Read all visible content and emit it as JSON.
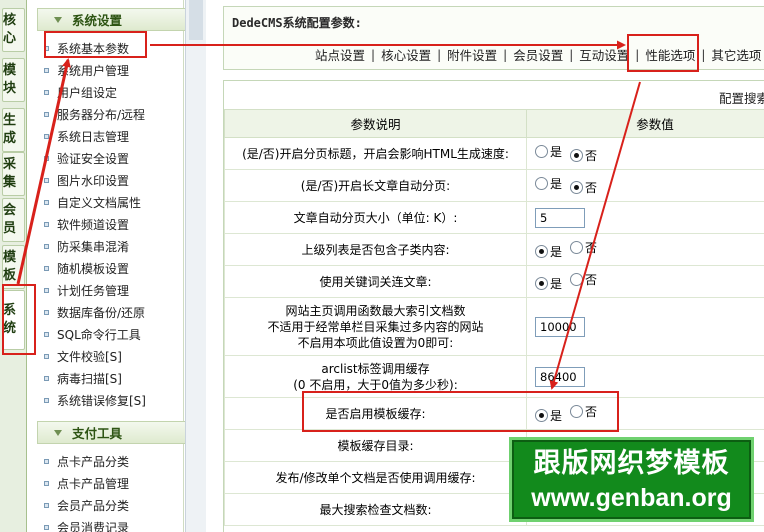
{
  "vertical_tabs": [
    "核心",
    "模块",
    "生成",
    "采集",
    "会员",
    "模板",
    "系统"
  ],
  "menu": {
    "sections": [
      {
        "title": "系统设置",
        "items": [
          "系统基本参数",
          "系统用户管理",
          "用户组设定",
          "服务器分布/远程",
          "系统日志管理",
          "验证安全设置",
          "图片水印设置",
          "自定义文档属性",
          "软件频道设置",
          "防采集串混淆",
          "随机模板设置",
          "计划任务管理",
          "数据库备份/还原",
          "SQL命令行工具",
          "文件校验[S]",
          "病毒扫描[S]",
          "系统错误修复[S]"
        ]
      },
      {
        "title": "支付工具",
        "items": [
          "点卡产品分类",
          "点卡产品管理",
          "会员产品分类",
          "会员消费记录"
        ]
      }
    ]
  },
  "main": {
    "title": "DedeCMS系统配置参数:",
    "tabs": [
      "站点设置",
      "核心设置",
      "附件设置",
      "会员设置",
      "互动设置",
      "性能选项",
      "其它选项"
    ],
    "config_search": "配置搜索",
    "table": {
      "headers": [
        "参数说明",
        "参数值"
      ],
      "rows": [
        {
          "desc": "(是/否)开启分页标题，开启会影响HTML生成速度:",
          "type": "radio",
          "selected": "否"
        },
        {
          "desc": "(是/否)开启长文章自动分页:",
          "type": "radio",
          "selected": "否"
        },
        {
          "desc": "文章自动分页大小（单位: K）:",
          "type": "text",
          "value": "5"
        },
        {
          "desc": "上级列表是否包含子类内容:",
          "type": "radio",
          "selected": "是"
        },
        {
          "desc": "使用关键词关连文章:",
          "type": "radio",
          "selected": "是"
        },
        {
          "desc": "网站主页调用函数最大索引文档数\n不适用于经常单栏目采集过多内容的网站\n不启用本项此值设置为0即可:",
          "type": "text",
          "value": "10000"
        },
        {
          "desc": "arclist标签调用缓存\n(0 不启用，大于0值为多少秒):",
          "type": "text",
          "value": "86400"
        },
        {
          "desc": "是否启用模板缓存:",
          "type": "radio",
          "selected": "是"
        },
        {
          "desc": "模板缓存目录:",
          "type": "none"
        },
        {
          "desc": "发布/修改单个文档是否使用调用缓存:",
          "type": "none"
        },
        {
          "desc": "最大搜索检查文档数:",
          "type": "none"
        }
      ],
      "radio_labels": [
        "是",
        "否"
      ]
    }
  },
  "watermark": {
    "line1": "跟版网织梦模板",
    "line2": "www.genban.org"
  },
  "colors": {
    "annotation_red": "#d8211b",
    "watermark_green": "#128a1c"
  }
}
